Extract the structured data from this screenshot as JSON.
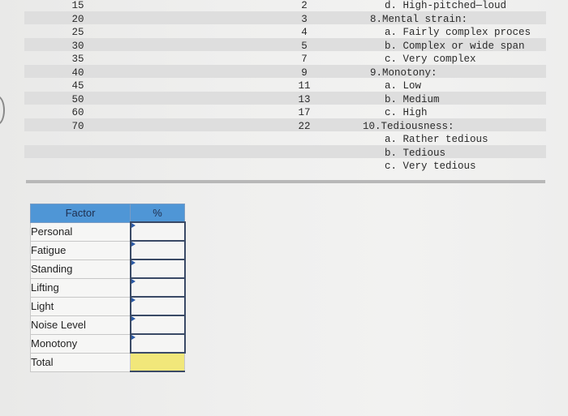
{
  "top_section": {
    "left_column": [
      "15",
      "20",
      "25",
      "30",
      "35",
      "40",
      "45",
      "50",
      "60",
      "70"
    ],
    "middle_column": [
      "2",
      "3",
      "4",
      "5",
      "7",
      "9",
      "11",
      "13",
      "17",
      "22"
    ],
    "right_column": [
      {
        "text": "d. High-pitched—loud",
        "indent": 2
      },
      {
        "text": "8.Mental strain:",
        "indent": 1
      },
      {
        "text": "a. Fairly complex proces",
        "indent": 2
      },
      {
        "text": "b. Complex or wide span",
        "indent": 2
      },
      {
        "text": "c. Very complex",
        "indent": 2
      },
      {
        "text": "9.Monotony:",
        "indent": 1
      },
      {
        "text": "a. Low",
        "indent": 2
      },
      {
        "text": "b. Medium",
        "indent": 2
      },
      {
        "text": "c. High",
        "indent": 2
      },
      {
        "text": "10.Tediousness:",
        "indent": 0
      },
      {
        "text": "a. Rather tedious",
        "indent": 2
      },
      {
        "text": "b. Tedious",
        "indent": 2
      },
      {
        "text": "c. Very tedious",
        "indent": 2
      }
    ]
  },
  "factor_table": {
    "headers": {
      "factor": "Factor",
      "percent": "%"
    },
    "rows": [
      {
        "label": "Personal",
        "value": ""
      },
      {
        "label": "Fatigue",
        "value": ""
      },
      {
        "label": "Standing",
        "value": ""
      },
      {
        "label": "Lifting",
        "value": ""
      },
      {
        "label": "Light",
        "value": ""
      },
      {
        "label": "Noise Level",
        "value": ""
      },
      {
        "label": "Monotony",
        "value": ""
      }
    ],
    "total": {
      "label": "Total",
      "value": ""
    },
    "colors": {
      "header": "#4f96d6",
      "total_cell": "#f1e77a",
      "input_border": "#3a4a66"
    }
  }
}
